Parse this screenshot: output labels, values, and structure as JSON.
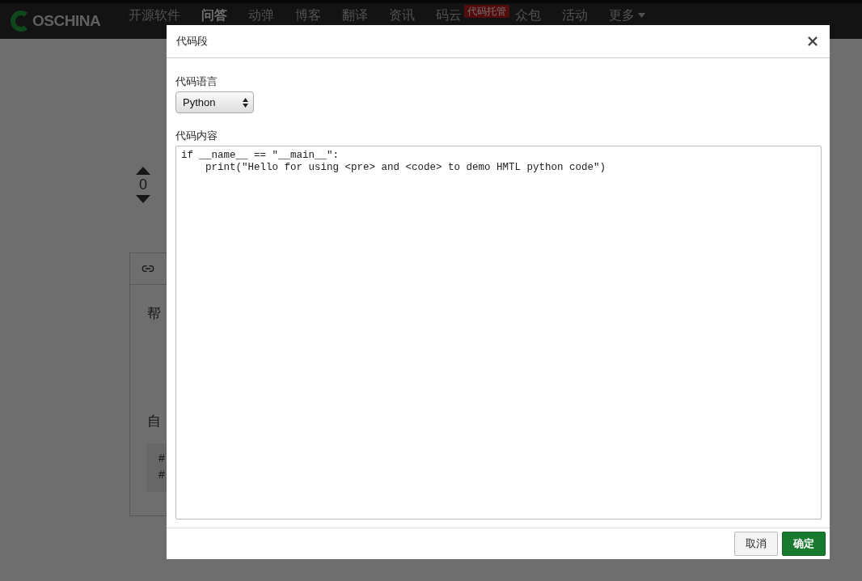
{
  "nav": {
    "logo": "OSCHINA",
    "items": [
      {
        "label": "开源软件",
        "selected": false
      },
      {
        "label": "问答",
        "selected": true
      },
      {
        "label": "动弹",
        "selected": false
      },
      {
        "label": "博客",
        "selected": false
      },
      {
        "label": "翻译",
        "selected": false
      },
      {
        "label": "资讯",
        "selected": false
      },
      {
        "label": "码云",
        "selected": false,
        "badge": "代码托管"
      },
      {
        "label": "众包",
        "selected": false
      },
      {
        "label": "活动",
        "selected": false
      },
      {
        "label": "更多",
        "selected": false,
        "dropdown": true
      }
    ]
  },
  "question": {
    "votes": "0",
    "panel_lines": [
      "帮",
      "自"
    ],
    "code_lines": [
      "#",
      "#"
    ]
  },
  "dialog": {
    "title": "代码段",
    "language_label": "代码语言",
    "language": "Python",
    "content_label": "代码内容",
    "code": [
      "if __name__ == \"__main__\":",
      "    print(\"Hello for using <pre> and <code> to demo HMTL python code\")"
    ],
    "buttons": [
      {
        "label": "取消",
        "kind": "cancel"
      },
      {
        "label": "确定",
        "kind": "primary"
      }
    ]
  }
}
